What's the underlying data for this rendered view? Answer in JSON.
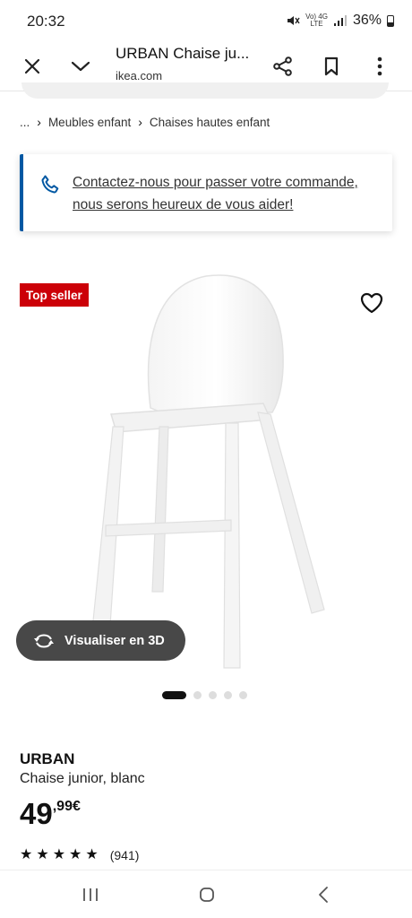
{
  "status_bar": {
    "time": "20:32",
    "network_top": "Vo) 4G",
    "network_bottom": "LTE",
    "battery": "36%"
  },
  "browser": {
    "title": "URBAN Chaise ju...",
    "url": "ikea.com"
  },
  "breadcrumb": {
    "ellipsis": "...",
    "items": [
      "Meubles enfant",
      "Chaises hautes enfant"
    ]
  },
  "contact": {
    "text": "Contactez-nous pour passer votre commande, nous serons heureux de vous aider!",
    "accent": "#0058a3"
  },
  "product": {
    "badge": "Top seller",
    "badge_color": "#cc0008",
    "view3d_label": "Visualiser en 3D",
    "carousel": {
      "count": 5,
      "active": 1
    },
    "name": "URBAN",
    "description": "Chaise junior, blanc",
    "price": {
      "integer": "49",
      "decimal": ",99",
      "currency": "€"
    },
    "rating": {
      "stars": 5,
      "count": "(941)"
    }
  },
  "icons": {
    "close": "close-icon",
    "collapse": "chevron-down-icon",
    "share": "share-icon",
    "bookmark": "bookmark-icon",
    "menu": "more-vertical-icon",
    "phone": "phone-icon",
    "favorite": "heart-icon",
    "rotate3d": "rotate-3d-icon"
  }
}
